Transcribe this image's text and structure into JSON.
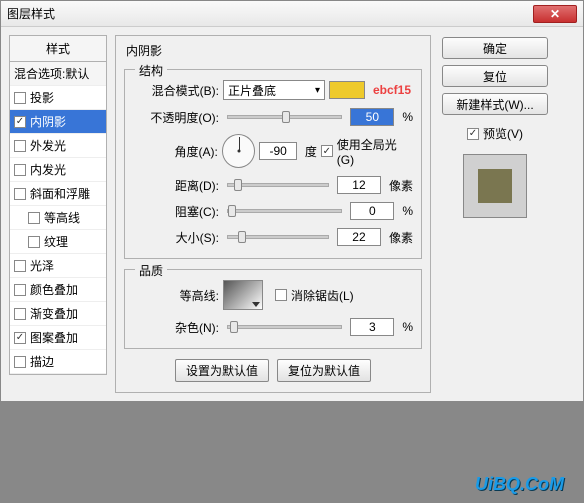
{
  "window": {
    "title": "图层样式"
  },
  "styles": {
    "header": "样式",
    "blend": "混合选项:默认",
    "items": [
      {
        "label": "投影",
        "checked": false,
        "indent": false
      },
      {
        "label": "内阴影",
        "checked": true,
        "selected": true,
        "indent": false
      },
      {
        "label": "外发光",
        "checked": false,
        "indent": false
      },
      {
        "label": "内发光",
        "checked": false,
        "indent": false
      },
      {
        "label": "斜面和浮雕",
        "checked": false,
        "indent": false
      },
      {
        "label": "等高线",
        "checked": false,
        "indent": true
      },
      {
        "label": "纹理",
        "checked": false,
        "indent": true
      },
      {
        "label": "光泽",
        "checked": false,
        "indent": false
      },
      {
        "label": "颜色叠加",
        "checked": false,
        "indent": false
      },
      {
        "label": "渐变叠加",
        "checked": false,
        "indent": false
      },
      {
        "label": "图案叠加",
        "checked": true,
        "indent": false
      },
      {
        "label": "描边",
        "checked": false,
        "indent": false
      }
    ]
  },
  "panel": {
    "title": "内阴影",
    "structure": {
      "legend": "结构",
      "blendMode": {
        "label": "混合模式(B):",
        "value": "正片叠底",
        "swatch": "#eeca2b",
        "note": "ebcf15"
      },
      "opacity": {
        "label": "不透明度(O):",
        "value": "50",
        "unit": "%"
      },
      "angle": {
        "label": "角度(A):",
        "value": "-90",
        "unit": "度",
        "global": {
          "label": "使用全局光(G)",
          "checked": true
        }
      },
      "distance": {
        "label": "距离(D):",
        "value": "12",
        "unit": "像素"
      },
      "choke": {
        "label": "阻塞(C):",
        "value": "0",
        "unit": "%"
      },
      "size": {
        "label": "大小(S):",
        "value": "22",
        "unit": "像素"
      }
    },
    "quality": {
      "legend": "品质",
      "contour": {
        "label": "等高线:",
        "antialias": {
          "label": "消除锯齿(L)",
          "checked": false
        }
      },
      "noise": {
        "label": "杂色(N):",
        "value": "3",
        "unit": "%"
      }
    },
    "buttons": {
      "setDefault": "设置为默认值",
      "resetDefault": "复位为默认值"
    }
  },
  "right": {
    "ok": "确定",
    "reset": "复位",
    "newStyle": "新建样式(W)...",
    "preview": {
      "label": "预览(V)",
      "checked": true
    }
  },
  "watermark": "UiBQ.CoM"
}
